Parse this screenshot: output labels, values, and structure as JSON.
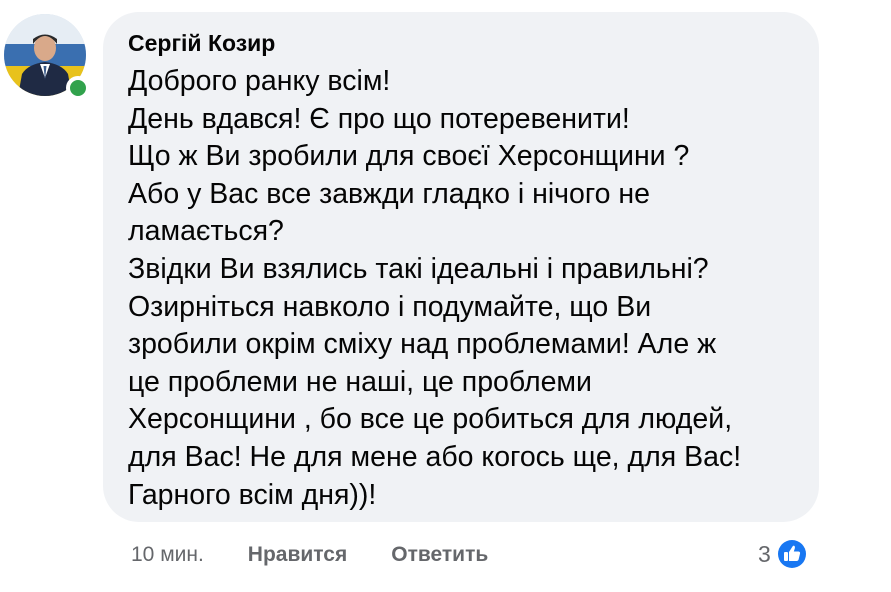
{
  "comment": {
    "author": "Сергій Козир",
    "lines": [
      "Доброго ранку всім!",
      "День вдався! Є про що потеревенити!",
      "Що ж Ви зробили для своєї Херсонщини ?",
      "Або у Вас все завжди гладко і нічого не",
      "ламається?",
      "Звідки Ви взялись такі ідеальні і правильні?",
      "Озирніться навколо і подумайте, що Ви",
      "зробили окрім сміху над проблемами! Але ж",
      "це проблеми не наші, це проблеми",
      "Херсонщини , бо все це робиться для людей,",
      "для Вас! Не для мене або когось ще, для Вас!",
      "Гарного всім дня))!"
    ],
    "online": true
  },
  "actions": {
    "time": "10 мин.",
    "like": "Нравится",
    "reply": "Ответить"
  },
  "reactions": {
    "count": "3",
    "icon": "like-thumbs-up-icon",
    "color": "#1877f2"
  },
  "colors": {
    "bubble": "#f0f2f5",
    "text": "#050505",
    "secondary": "#65676b",
    "online": "#31a24c"
  }
}
